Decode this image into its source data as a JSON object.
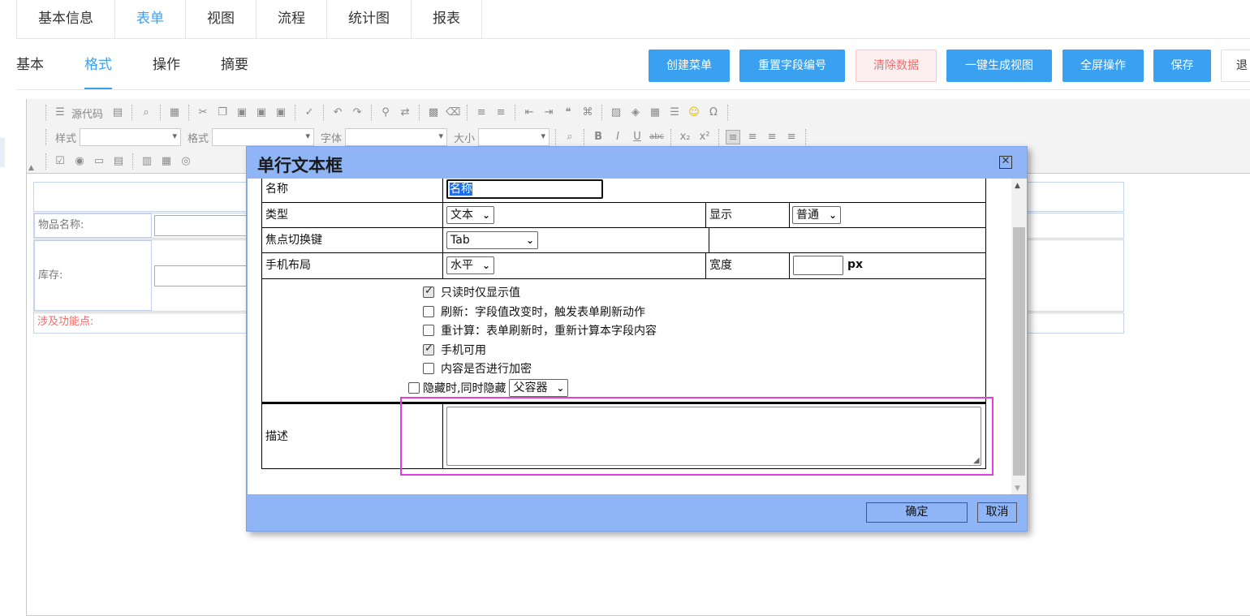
{
  "top_tabs": [
    {
      "label": "基本信息",
      "active": false
    },
    {
      "label": "表单",
      "active": true
    },
    {
      "label": "视图",
      "active": false
    },
    {
      "label": "流程",
      "active": false
    },
    {
      "label": "统计图",
      "active": false
    },
    {
      "label": "报表",
      "active": false
    }
  ],
  "sub_tabs": [
    {
      "label": "基本",
      "active": false
    },
    {
      "label": "格式",
      "active": true
    },
    {
      "label": "操作",
      "active": false
    },
    {
      "label": "摘要",
      "active": false
    }
  ],
  "actions": {
    "create_menu": "创建菜单",
    "reset_field_number": "重置字段编号",
    "clear_data": "清除数据",
    "generate_view": "一键生成视图",
    "fullscreen": "全屏操作",
    "save": "保存",
    "exit": "退"
  },
  "toolbar": {
    "source_label": "源代码",
    "style_label": "样式",
    "format_label": "格式",
    "font_label": "字体",
    "size_label": "大小"
  },
  "form_background": {
    "item_name_label": "物品名称:",
    "stock_label": "库存:",
    "feature_label": "涉及功能点:"
  },
  "dialog": {
    "title": "单行文本框",
    "name_label": "名称",
    "name_value": "名称",
    "type_label": "类型",
    "type_value": "文本",
    "display_label": "显示",
    "display_value": "普通",
    "focus_key_label": "焦点切换键",
    "focus_key_value": "Tab",
    "mobile_layout_label": "手机布局",
    "mobile_layout_value": "水平",
    "width_label": "宽度",
    "width_value": "",
    "width_unit": "px",
    "options": [
      {
        "label": "只读时仅显示值",
        "checked": true
      },
      {
        "label": "刷新：字段值改变时，触发表单刷新动作",
        "checked": false
      },
      {
        "label": "重计算：表单刷新时，重新计算本字段内容",
        "checked": false
      },
      {
        "label": "手机可用",
        "checked": true
      },
      {
        "label": "内容是否进行加密",
        "checked": false
      }
    ],
    "hide_label": "隐藏时,同时隐藏",
    "hide_target": "父容器",
    "description_label": "描述",
    "description_value": "",
    "confirm": "确定",
    "cancel": "取消"
  },
  "colors": {
    "accent": "#3aa0f0",
    "dialog_bg": "#8fb5f7",
    "highlight": "#e23fe0",
    "danger": "#f56c6c"
  }
}
